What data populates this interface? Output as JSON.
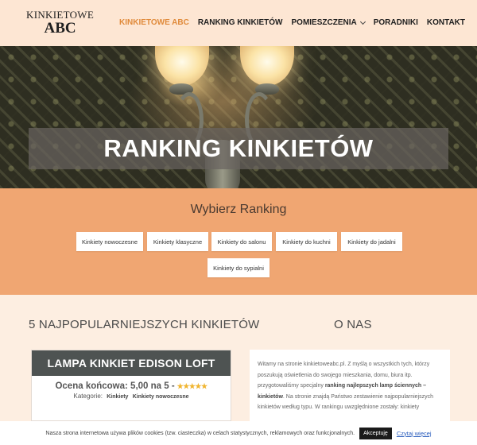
{
  "logo": {
    "line1": "KINKIETOWE",
    "line2": "ABC"
  },
  "nav": [
    {
      "label": "KINKIETOWE ABC",
      "active": true
    },
    {
      "label": "RANKING KINKIETÓW",
      "active": false
    },
    {
      "label": "POMIESZCZENIA",
      "active": false,
      "dropdown": true
    },
    {
      "label": "PORADNIKI",
      "active": false
    },
    {
      "label": "KONTAKT",
      "active": false
    }
  ],
  "hero": {
    "title": "RANKING KINKIETÓW"
  },
  "ranking": {
    "title": "Wybierz Ranking",
    "buttons": [
      "Kinkiety nowoczesne",
      "Kinkiety klasyczne",
      "Kinkiety do salonu",
      "Kinkiety do kuchni",
      "Kinkiety do jadalni",
      "Kinkiety do sypialni"
    ]
  },
  "popular": {
    "title": "5 NAJPOPULARNIEJSZYCH KINKIETÓW",
    "card": {
      "product": "LAMPA KINKIET EDISON LOFT",
      "rating_label": "Ocena końcowa: 5,00 na 5 -",
      "stars": "★★★★★",
      "category_label": "Kategorie:",
      "categories": [
        "Kinkiety",
        "Kinkiety nowoczesne"
      ]
    }
  },
  "about": {
    "title": "O NAS",
    "text_1": "Witamy na stronie kinkietoweabc.pl. Z myślą o wszystkich tych, którzy poszukują oświetlenia do swojego mieszkania, domu, biura itp. przygotowaliśmy specjalny ",
    "text_bold": "ranking najlepszych lamp ściennych – kinkietów",
    "text_2": ". Na stronie znajdą Państwo zestawienie najpopularniejszych kinkietów według typu. W rankingu uwzględnione zostały: kinkiety"
  },
  "cookie": {
    "text": "Nasza strona internetowa używa plików cookies (tzw. ciasteczka) w celach statystycznych, reklamowych oraz funkcjonalnych.",
    "accept": "Akceptuję",
    "more": "Czytaj więcej"
  },
  "colors": {
    "accent": "#e08a3a",
    "band": "#f0a672",
    "card_head": "#4e5352",
    "page_bg": "#fdeee1"
  }
}
